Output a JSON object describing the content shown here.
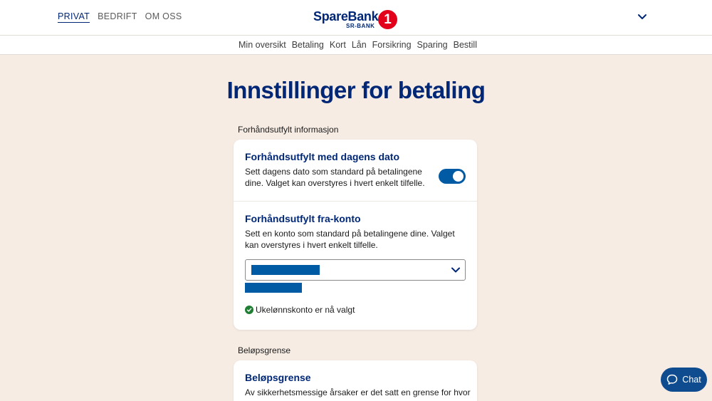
{
  "header": {
    "segments": [
      "PRIVAT",
      "BEDRIFT",
      "OM OSS"
    ],
    "logo": {
      "name": "SpareBank",
      "sub": "SR-BANK",
      "badge": "1"
    }
  },
  "subnav": {
    "items": [
      "Min oversikt",
      "Betaling",
      "Kort",
      "Lån",
      "Forsikring",
      "Sparing",
      "Bestill"
    ]
  },
  "page": {
    "title": "Innstillinger for betaling"
  },
  "sections": {
    "prefill": {
      "label": "Forhåndsutfylt informasjon",
      "date": {
        "title": "Forhåndsutfylt med dagens dato",
        "desc_line1": "Sett dagens dato som standard på betalingene",
        "desc_line2": "dine. Valget kan overstyres i hvert enkelt tilfelle.",
        "toggle_on": true
      },
      "account": {
        "title": "Forhåndsutfylt fra-konto",
        "desc_line1": "Sett en konto som standard på betalingene dine. Valget",
        "desc_line2": "kan overstyres i hvert enkelt tilfelle.",
        "status": "Ukelønnskonto er nå valgt"
      }
    },
    "limit": {
      "label": "Beløpsgrense",
      "title": "Beløpsgrense",
      "desc_line1": "Av sikkerhetsmessige årsaker er det satt en grense for hvor"
    }
  },
  "chat": {
    "label": "Chat"
  },
  "colors": {
    "brand": "#002776",
    "accent": "#005aa4",
    "logo_red": "#e2001a",
    "background": "#f6ece4"
  }
}
